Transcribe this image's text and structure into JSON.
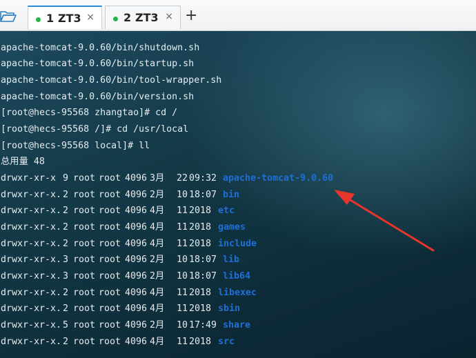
{
  "tabs": [
    {
      "num": "1",
      "name": "ZT3",
      "close": "×",
      "active": true
    },
    {
      "num": "2",
      "name": "ZT3",
      "close": "×",
      "active": false
    }
  ],
  "add_tab_label": "+",
  "terminal": {
    "lines": [
      "apache-tomcat-9.0.60/bin/shutdown.sh",
      "apache-tomcat-9.0.60/bin/startup.sh",
      "apache-tomcat-9.0.60/bin/tool-wrapper.sh",
      "apache-tomcat-9.0.60/bin/version.sh",
      "[root@hecs-95568 zhangtao]# cd /",
      "[root@hecs-95568 /]# cd /usr/local",
      "[root@hecs-95568 local]# ll",
      "总用量 48"
    ],
    "listing": [
      {
        "perm": "drwxr-xr-x",
        "links": "9",
        "owner": "root",
        "group": "root",
        "size": "4096",
        "month": "3月",
        "day": "22",
        "time": "09:32",
        "name": "apache-tomcat-9.0.60"
      },
      {
        "perm": "drwxr-xr-x.",
        "links": "2",
        "owner": "root",
        "group": "root",
        "size": "4096",
        "month": "2月",
        "day": "10",
        "time": "18:07",
        "name": "bin"
      },
      {
        "perm": "drwxr-xr-x.",
        "links": "2",
        "owner": "root",
        "group": "root",
        "size": "4096",
        "month": "4月",
        "day": "11",
        "time": "2018",
        "name": "etc"
      },
      {
        "perm": "drwxr-xr-x.",
        "links": "2",
        "owner": "root",
        "group": "root",
        "size": "4096",
        "month": "4月",
        "day": "11",
        "time": "2018",
        "name": "games"
      },
      {
        "perm": "drwxr-xr-x.",
        "links": "2",
        "owner": "root",
        "group": "root",
        "size": "4096",
        "month": "4月",
        "day": "11",
        "time": "2018",
        "name": "include"
      },
      {
        "perm": "drwxr-xr-x.",
        "links": "3",
        "owner": "root",
        "group": "root",
        "size": "4096",
        "month": "2月",
        "day": "10",
        "time": "18:07",
        "name": "lib"
      },
      {
        "perm": "drwxr-xr-x.",
        "links": "3",
        "owner": "root",
        "group": "root",
        "size": "4096",
        "month": "2月",
        "day": "10",
        "time": "18:07",
        "name": "lib64"
      },
      {
        "perm": "drwxr-xr-x.",
        "links": "2",
        "owner": "root",
        "group": "root",
        "size": "4096",
        "month": "4月",
        "day": "11",
        "time": "2018",
        "name": "libexec"
      },
      {
        "perm": "drwxr-xr-x.",
        "links": "2",
        "owner": "root",
        "group": "root",
        "size": "4096",
        "month": "4月",
        "day": "11",
        "time": "2018",
        "name": "sbin"
      },
      {
        "perm": "drwxr-xr-x.",
        "links": "5",
        "owner": "root",
        "group": "root",
        "size": "4096",
        "month": "2月",
        "day": "10",
        "time": "17:49",
        "name": "share"
      },
      {
        "perm": "drwxr-xr-x.",
        "links": "2",
        "owner": "root",
        "group": "root",
        "size": "4096",
        "month": "4月",
        "day": "11",
        "time": "2018",
        "name": "src"
      }
    ]
  },
  "colors": {
    "directory": "#1f6fd6",
    "annotation_arrow": "#e8352b",
    "active_tab_accent": "#2a8bdc",
    "status_dot": "#29b34a"
  },
  "icons": {
    "folder": "folder-icon",
    "close": "close-icon",
    "add": "plus-icon",
    "annotation": "red-arrow"
  }
}
